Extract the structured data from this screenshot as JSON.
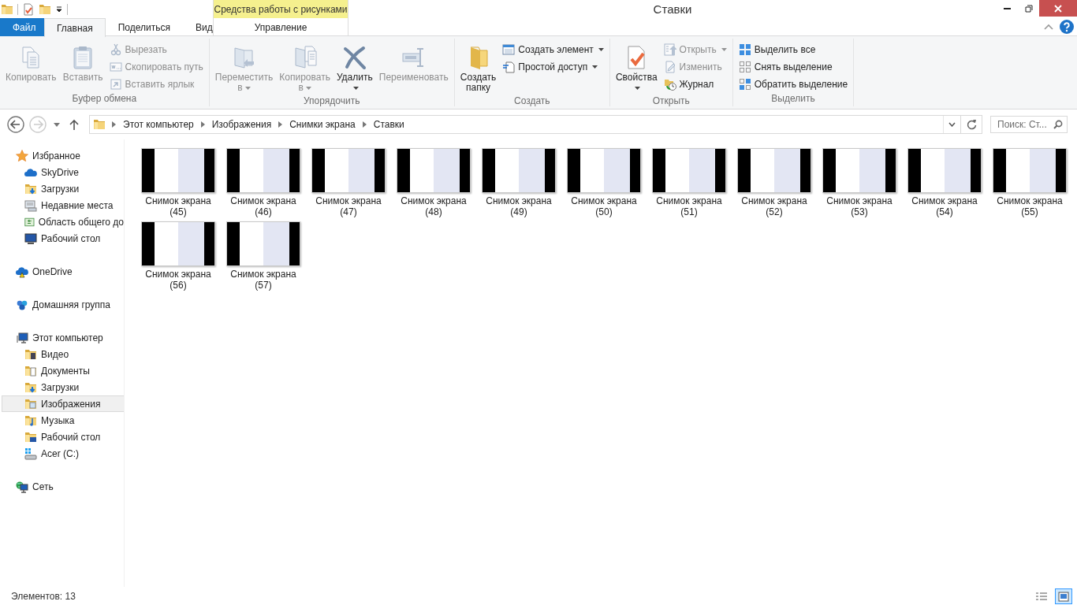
{
  "window": {
    "title": "Ставки"
  },
  "contextual_group": {
    "title": "Средства работы с рисунками"
  },
  "tabs": [
    {
      "label": "Файл",
      "kind": "file",
      "selected": false
    },
    {
      "label": "Главная",
      "kind": "normal",
      "selected": true
    },
    {
      "label": "Поделиться",
      "kind": "normal",
      "selected": false
    },
    {
      "label": "Вид",
      "kind": "normal",
      "selected": false
    },
    {
      "label": "Управление",
      "kind": "contextual",
      "selected": false
    }
  ],
  "ribbon": {
    "groups": [
      {
        "label": "Буфер обмена",
        "commands": [
          {
            "label": "Копировать",
            "kind": "large",
            "disabled": true,
            "dropdown": false
          },
          {
            "label": "Вставить",
            "kind": "large",
            "disabled": true,
            "dropdown": false
          },
          {
            "label": "Вырезать",
            "kind": "small",
            "disabled": true,
            "dropdown": false
          },
          {
            "label": "Скопировать путь",
            "kind": "small",
            "disabled": true,
            "dropdown": false
          },
          {
            "label": "Вставить ярлык",
            "kind": "small",
            "disabled": true,
            "dropdown": false
          }
        ]
      },
      {
        "label": "Упорядочить",
        "commands": [
          {
            "label": "Переместить в",
            "kind": "large",
            "disabled": true,
            "dropdown": true
          },
          {
            "label": "Копировать в",
            "kind": "large",
            "disabled": true,
            "dropdown": true
          },
          {
            "label": "Удалить",
            "kind": "large",
            "disabled": false,
            "dropdown": true
          },
          {
            "label": "Переименовать",
            "kind": "large",
            "disabled": true,
            "dropdown": false
          }
        ]
      },
      {
        "label": "Создать",
        "commands": [
          {
            "label": "Создать папку",
            "kind": "large",
            "disabled": false,
            "dropdown": false
          },
          {
            "label": "Создать элемент",
            "kind": "small",
            "disabled": false,
            "dropdown": true
          },
          {
            "label": "Простой доступ",
            "kind": "small",
            "disabled": false,
            "dropdown": true
          }
        ]
      },
      {
        "label": "Открыть",
        "commands": [
          {
            "label": "Свойства",
            "kind": "large",
            "disabled": false,
            "dropdown": true
          },
          {
            "label": "Открыть",
            "kind": "small",
            "disabled": true,
            "dropdown": true
          },
          {
            "label": "Изменить",
            "kind": "small",
            "disabled": true,
            "dropdown": false
          },
          {
            "label": "Журнал",
            "kind": "small",
            "disabled": false,
            "dropdown": false
          }
        ]
      },
      {
        "label": "Выделить",
        "commands": [
          {
            "label": "Выделить все",
            "kind": "small",
            "disabled": false,
            "dropdown": false
          },
          {
            "label": "Снять выделение",
            "kind": "small",
            "disabled": false,
            "dropdown": false
          },
          {
            "label": "Обратить выделение",
            "kind": "small",
            "disabled": false,
            "dropdown": false
          }
        ]
      }
    ]
  },
  "navigation": {
    "back": {
      "disabled": false
    },
    "forward": {
      "disabled": true
    },
    "breadcrumbs": [
      "Этот компьютер",
      "Изображения",
      "Снимки экрана",
      "Ставки"
    ],
    "search": {
      "placeholder": "Поиск: Ст..."
    }
  },
  "navigation_pane": {
    "items": [
      {
        "label": "Избранное",
        "selected": false,
        "children": [
          {
            "label": "SkyDrive",
            "selected": false
          },
          {
            "label": "Загрузки",
            "selected": false
          },
          {
            "label": "Недавние места",
            "selected": false
          },
          {
            "label": "Область общего до",
            "selected": false
          },
          {
            "label": "Рабочий стол",
            "selected": false
          }
        ]
      },
      {
        "label": "OneDrive",
        "selected": false
      },
      {
        "label": "Домашняя группа",
        "selected": false
      },
      {
        "label": "Этот компьютер",
        "selected": false,
        "children": [
          {
            "label": "Видео",
            "selected": false
          },
          {
            "label": "Документы",
            "selected": false
          },
          {
            "label": "Загрузки",
            "selected": false
          },
          {
            "label": "Изображения",
            "selected": true
          },
          {
            "label": "Музыка",
            "selected": false
          },
          {
            "label": "Рабочий стол",
            "selected": false
          },
          {
            "label": "Acer (C:)",
            "selected": false
          }
        ]
      },
      {
        "label": "Сеть",
        "selected": false
      }
    ]
  },
  "files": [
    {
      "name": "Снимок экрана (45)"
    },
    {
      "name": "Снимок экрана (46)"
    },
    {
      "name": "Снимок экрана (47)"
    },
    {
      "name": "Снимок экрана (48)"
    },
    {
      "name": "Снимок экрана (49)"
    },
    {
      "name": "Снимок экрана (50)"
    },
    {
      "name": "Снимок экрана (51)"
    },
    {
      "name": "Снимок экрана (52)"
    },
    {
      "name": "Снимок экрана (53)"
    },
    {
      "name": "Снимок экрана (54)"
    },
    {
      "name": "Снимок экрана (55)"
    },
    {
      "name": "Снимок экрана (56)"
    },
    {
      "name": "Снимок экрана (57)"
    }
  ],
  "status_bar": {
    "item_count": "Элементов: 13",
    "view_modes": [
      {
        "selected": false
      },
      {
        "selected": true
      }
    ]
  }
}
